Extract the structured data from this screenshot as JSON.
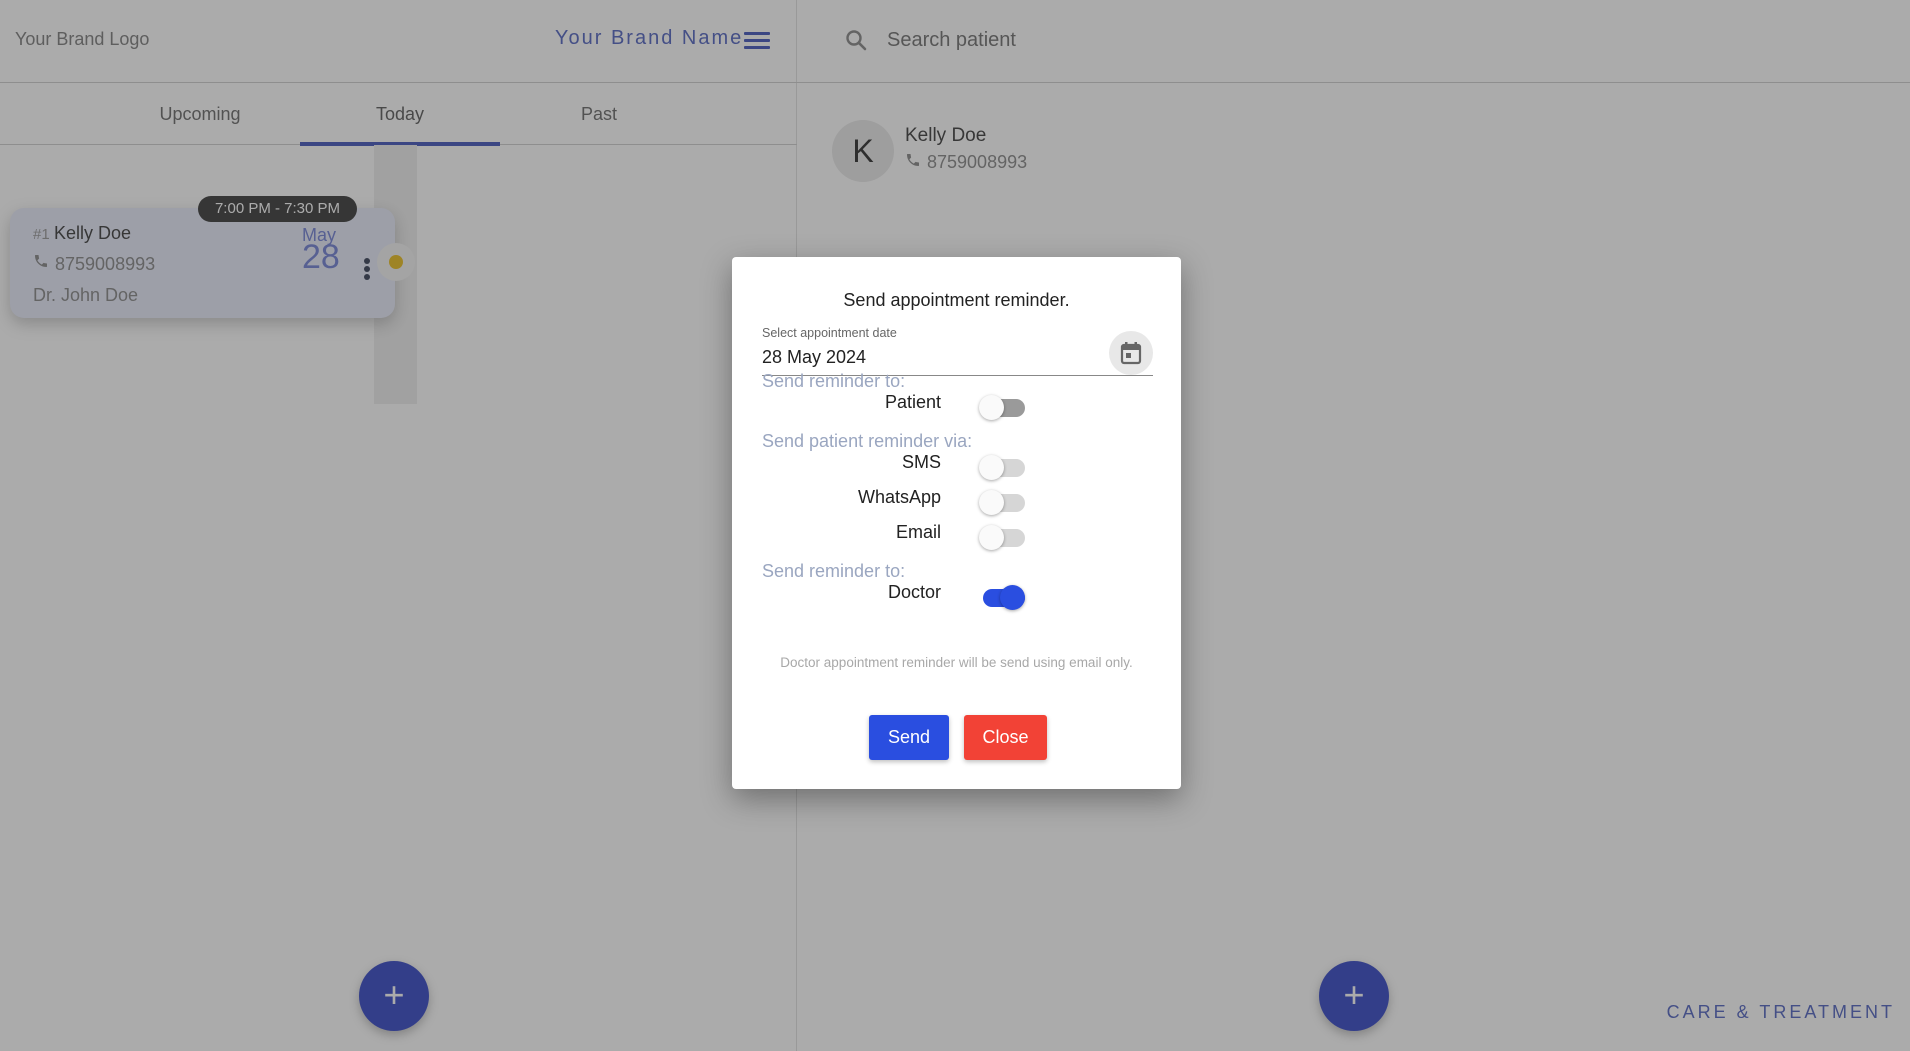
{
  "header": {
    "brand_logo": "Your Brand Logo",
    "brand_name": "Your Brand Name",
    "menu_icon": "hamburger-menu-icon"
  },
  "tabs": [
    {
      "label": "Upcoming",
      "active": false
    },
    {
      "label": "Today",
      "active": true
    },
    {
      "label": "Past",
      "active": false
    }
  ],
  "appointment": {
    "time": "7:00 PM - 7:30 PM",
    "number": "#1",
    "patient_name": "Kelly Doe",
    "phone": "8759008993",
    "doctor": "Dr. John Doe",
    "month": "May",
    "day": "28",
    "status_color": "#e6b400"
  },
  "search": {
    "placeholder": "Search patient",
    "value": ""
  },
  "patient_list": [
    {
      "initial": "K",
      "name": "Kelly Doe",
      "phone": "8759008993"
    }
  ],
  "fab_label": "+",
  "footer_tagline": "CARE & TREATMENT",
  "modal": {
    "title": "Send appointment reminder.",
    "date_label": "Select appointment date",
    "date_value": "28 May 2024",
    "section_patient": "Send reminder to:",
    "patient_toggle": {
      "label": "Patient",
      "on": false
    },
    "section_via": "Send patient reminder via:",
    "via_toggles": [
      {
        "label": "SMS",
        "on": false
      },
      {
        "label": "WhatsApp",
        "on": false
      },
      {
        "label": "Email",
        "on": false
      }
    ],
    "section_doctor": "Send reminder to:",
    "doctor_toggle": {
      "label": "Doctor",
      "on": true
    },
    "note": "Doctor appointment reminder will be send using email only.",
    "send_label": "Send",
    "close_label": "Close"
  },
  "colors": {
    "accent": "#2a3fb3",
    "send": "#2a4ee0",
    "close": "#f24236",
    "status_pending": "#e6b400"
  }
}
